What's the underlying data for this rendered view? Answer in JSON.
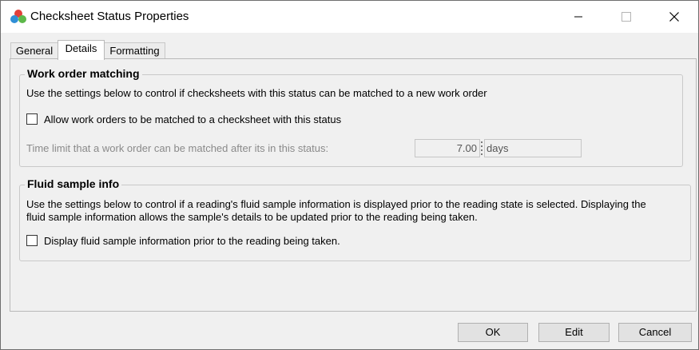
{
  "window": {
    "title": "Checksheet Status Properties",
    "icon": "app-logo-icon",
    "controls": [
      "minimize-icon",
      "maximize-icon",
      "close-icon"
    ]
  },
  "tabs": [
    {
      "label": "General",
      "active": false
    },
    {
      "label": "Details",
      "active": true
    },
    {
      "label": "Formatting",
      "active": false
    }
  ],
  "work_order": {
    "group_title": "Work order matching",
    "description": "Use the settings below to control if checksheets with this status can be matched to a new work order",
    "allow_label": "Allow work orders to be matched to a checksheet with this status",
    "allow_checked": false,
    "time_limit_label": "Time limit that a work order can be matched after its in this status:",
    "time_limit_value": "7.00",
    "time_limit_unit": "days"
  },
  "fluid": {
    "group_title": "Fluid sample info",
    "description_line1": "Use the settings below to control if a reading's fluid sample information is displayed prior to the reading state is selected.  Displaying the",
    "description_line2": "fluid sample information allows the sample's details to be updated prior to the reading being taken.",
    "display_label": "Display fluid sample information prior to the reading being taken.",
    "display_checked": false
  },
  "buttons": {
    "ok": "OK",
    "edit": "Edit",
    "cancel": "Cancel"
  }
}
